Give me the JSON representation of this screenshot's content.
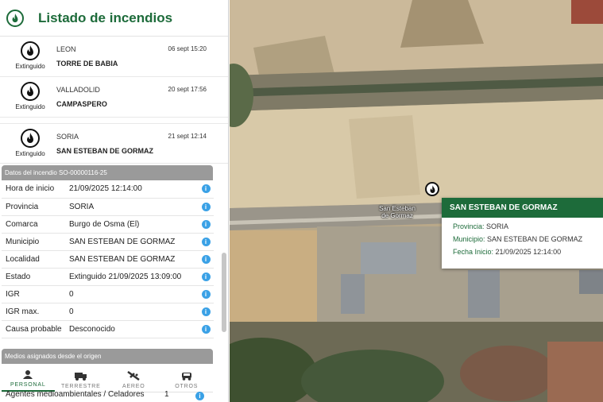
{
  "header": {
    "title": "Listado de incendios",
    "logo_icon": "fire-icon"
  },
  "fires": [
    {
      "status": "Extinguido",
      "province": "LEON",
      "date": "06 sept 15:20",
      "name": "TORRE DE BABIA"
    },
    {
      "status": "Extinguido",
      "province": "VALLADOLID",
      "date": "20 sept 17:56",
      "name": "CAMPASPERO"
    },
    {
      "status": "Extinguido",
      "province": "SORIA",
      "date": "21 sept 12:14",
      "name": "SAN ESTEBAN DE GORMAZ"
    }
  ],
  "details": {
    "title": "Datos del incendio SO-00000116-25",
    "rows": [
      {
        "label": "Hora de inicio",
        "value": "21/09/2025 12:14:00"
      },
      {
        "label": "Provincia",
        "value": "SORIA"
      },
      {
        "label": "Comarca",
        "value": "Burgo de Osma (El)"
      },
      {
        "label": "Municipio",
        "value": "SAN ESTEBAN DE GORMAZ"
      },
      {
        "label": "Localidad",
        "value": "SAN ESTEBAN DE GORMAZ"
      },
      {
        "label": "Estado",
        "value": "Extinguido 21/09/2025 13:09:00"
      },
      {
        "label": "IGR",
        "value": "0"
      },
      {
        "label": "IGR max.",
        "value": "0"
      },
      {
        "label": "Causa probable",
        "value": "Desconocido"
      }
    ]
  },
  "medios": {
    "title": "Medios asignados desde el origen",
    "tabs": [
      {
        "label": "PERSONAL",
        "icon": "person-icon",
        "active": true
      },
      {
        "label": "TERRESTRE",
        "icon": "truck-icon",
        "active": false
      },
      {
        "label": "AEREO",
        "icon": "plane-icon",
        "active": false
      },
      {
        "label": "OTROS",
        "icon": "vehicle-icon",
        "active": false
      }
    ],
    "rows": [
      {
        "label": "Agentes medioambientales / Celadores",
        "count": "1"
      }
    ]
  },
  "map": {
    "marker_label": "San Esteban de Gormaz",
    "popup": {
      "title": "SAN ESTEBAN DE GORMAZ",
      "province_label": "Provincia:",
      "province": "SORIA",
      "municipality_label": "Municipio:",
      "municipality": "SAN ESTEBAN DE GORMAZ",
      "start_label": "Fecha Inicio:",
      "start": "21/09/2025 12:14:00"
    }
  },
  "colors": {
    "brand_green": "#1d6b3a",
    "info_blue": "#3aa1e6",
    "section_gray": "#9a9a9a"
  }
}
